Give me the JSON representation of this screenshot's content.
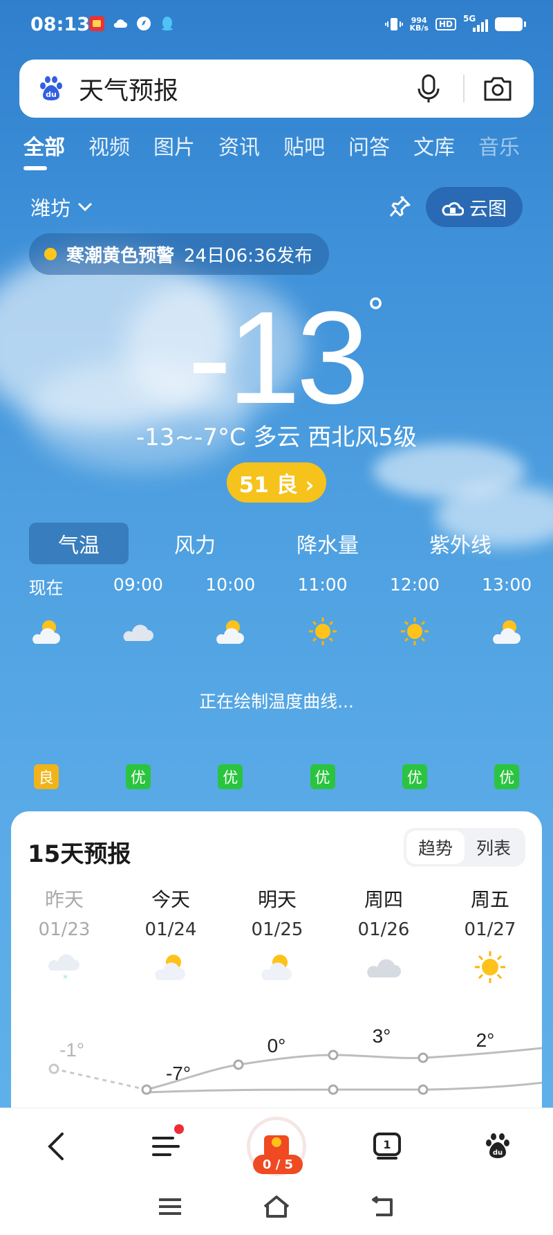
{
  "status_bar": {
    "time": "08:13",
    "net_speed_value": "994",
    "net_speed_unit": "KB/s",
    "hd": "HD",
    "signal": "5G"
  },
  "search": {
    "query": "天气预报"
  },
  "tabs": [
    "全部",
    "视频",
    "图片",
    "资讯",
    "贴吧",
    "问答",
    "文库",
    "音乐"
  ],
  "location": {
    "city": "潍坊",
    "cloud_map_label": "云图"
  },
  "warning": {
    "title": "寒潮黄色预警",
    "time": "24日06:36发布",
    "level_color": "#ffc619"
  },
  "current": {
    "temperature": "-13",
    "degree": "°",
    "summary": "-13~-7°C 多云 西北风5级",
    "aqi_label": "51 良 ›",
    "aqi_color": "#f6c21c"
  },
  "mode_tabs": [
    "气温",
    "风力",
    "降水量",
    "紫外线"
  ],
  "hourly": {
    "times": [
      "现在",
      "09:00",
      "10:00",
      "11:00",
      "12:00",
      "13:00"
    ],
    "icons": [
      "partly-cloudy-icon",
      "cloud-icon",
      "partly-cloudy-icon",
      "sun-icon",
      "sun-icon",
      "partly-cloudy-icon"
    ],
    "drawing_text": "正在绘制温度曲线...",
    "aqi": [
      {
        "label": "良",
        "color": "#f0b41a"
      },
      {
        "label": "优",
        "color": "#2bc43f"
      },
      {
        "label": "优",
        "color": "#2bc43f"
      },
      {
        "label": "优",
        "color": "#2bc43f"
      },
      {
        "label": "优",
        "color": "#2bc43f"
      },
      {
        "label": "优",
        "color": "#2bc43f"
      }
    ]
  },
  "forecast": {
    "title": "15天预报",
    "toggle": [
      "趋势",
      "列表"
    ],
    "days": [
      {
        "name": "昨天",
        "date": "01/23",
        "icon": "snow-cloud-icon",
        "high": "-1°",
        "past": true
      },
      {
        "name": "今天",
        "date": "01/24",
        "icon": "partly-cloudy-icon",
        "high": "-7°",
        "past": false
      },
      {
        "name": "明天",
        "date": "01/25",
        "icon": "partly-cloudy-icon",
        "high": "0°",
        "past": false
      },
      {
        "name": "周四",
        "date": "01/26",
        "icon": "cloud-icon",
        "high": "3°",
        "past": false
      },
      {
        "name": "周五",
        "date": "01/27",
        "icon": "sun-icon",
        "high": "2°",
        "past": false
      }
    ]
  },
  "bottom_nav": {
    "reward_count": "0 / 5",
    "tab_count": "1"
  }
}
